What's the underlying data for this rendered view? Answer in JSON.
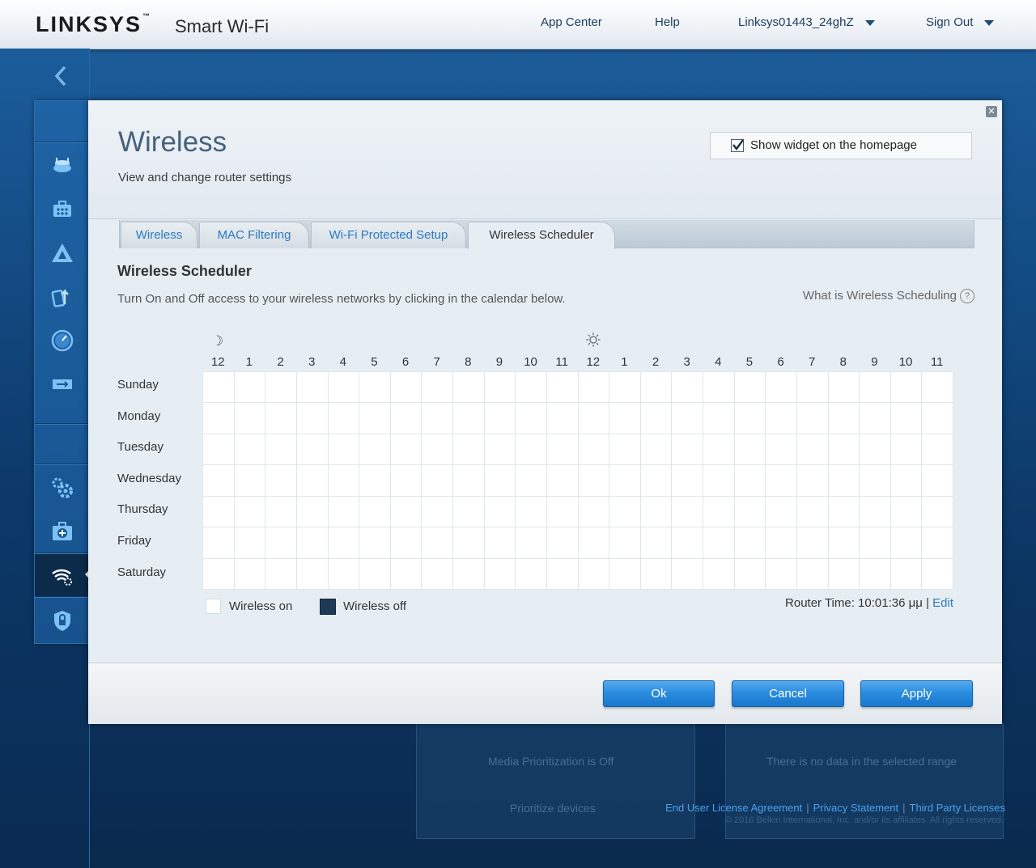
{
  "header": {
    "brand": "LINKSYS",
    "brand_tm": "™",
    "brand_sub": "Smart Wi-Fi",
    "app_center": "App Center",
    "help": "Help",
    "network_name": "Linksys01443_24ghZ",
    "sign_out": "Sign Out"
  },
  "sidebar": {
    "icons": [
      "router-icon",
      "toolbox-icon",
      "network-map-icon",
      "media-prioritization-icon",
      "speed-test-icon",
      "usb-storage-icon",
      "connectivity-settings-icon",
      "troubleshooting-icon",
      "wireless-icon",
      "security-icon"
    ],
    "active": "wireless-icon"
  },
  "background": {
    "ghost_text_1": "Media Prioritization is Off",
    "ghost_text_2": "Prioritize devices",
    "ghost_text_3": "There is no data in the selected range"
  },
  "modal": {
    "title": "Wireless",
    "subtitle": "View and change router settings",
    "show_widget_label": "Show widget on the homepage",
    "show_widget_checked": true,
    "close": "✕",
    "tabs": [
      {
        "label": "Wireless",
        "active": false
      },
      {
        "label": "MAC Filtering",
        "active": false
      },
      {
        "label": "Wi-Fi Protected Setup",
        "active": false
      },
      {
        "label": "Wireless Scheduler",
        "active": true
      }
    ],
    "section_title": "Wireless Scheduler",
    "section_desc": "Turn On and Off access to your wireless networks by clicking in the calendar below.",
    "help_link": "What is Wireless Scheduling",
    "help_q": "?",
    "moon": "☽",
    "hours": [
      "12",
      "1",
      "2",
      "3",
      "4",
      "5",
      "6",
      "7",
      "8",
      "9",
      "10",
      "11",
      "12",
      "1",
      "2",
      "3",
      "4",
      "5",
      "6",
      "7",
      "8",
      "9",
      "10",
      "11"
    ],
    "days": [
      "Sunday",
      "Monday",
      "Tuesday",
      "Wednesday",
      "Thursday",
      "Friday",
      "Saturday"
    ],
    "legend_on": "Wireless on",
    "legend_off": "Wireless off",
    "router_time_label": "Router Time: 10:01:36 μμ | ",
    "router_time_edit": "Edit",
    "buttons": {
      "ok": "Ok",
      "cancel": "Cancel",
      "apply": "Apply"
    }
  },
  "footer": {
    "eula": "End User License Agreement",
    "privacy": "Privacy Statement",
    "third_party": "Third Party Licenses",
    "separator": "|",
    "copyright": "© 2016 Belkin International, Inc. and/or its affiliates. All rights reserved."
  },
  "colors": {
    "accent_blue": "#2b7ac0",
    "wireless_off": "#1f3a56",
    "wireless_on": "#ffffff"
  }
}
